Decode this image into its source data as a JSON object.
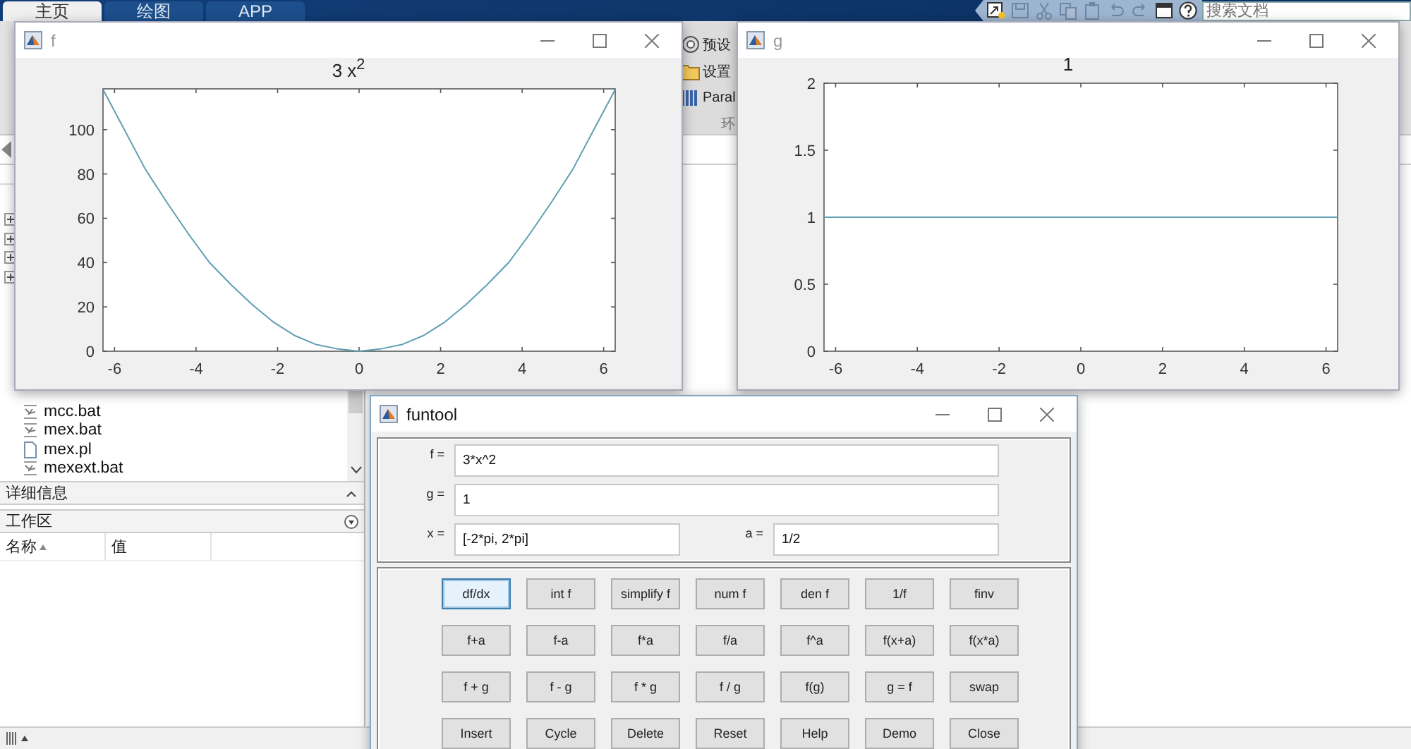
{
  "main_tabs": [
    {
      "label": "主页",
      "selected": true
    },
    {
      "label": "绘图",
      "selected": false
    },
    {
      "label": "APP",
      "selected": false
    }
  ],
  "search": {
    "placeholder": "搜索文档"
  },
  "ribbon": {
    "items": [
      {
        "kind": "gear",
        "label": "预设"
      },
      {
        "kind": "folder",
        "label": "设置"
      },
      {
        "kind": "parallel",
        "label": "Paral"
      }
    ],
    "section": "环"
  },
  "tree_nodes": [
    {
      "expanded": false
    },
    {
      "expanded": false
    },
    {
      "expanded": false
    },
    {
      "expanded": false
    }
  ],
  "files": [
    {
      "name": "mcc.bat",
      "kind": "bat"
    },
    {
      "name": "mex.bat",
      "kind": "bat"
    },
    {
      "name": "mex.pl",
      "kind": "file"
    },
    {
      "name": "mexext.bat",
      "kind": "bat"
    }
  ],
  "details_panel": {
    "title": "详细信息"
  },
  "workspace": {
    "title": "工作区",
    "columns": [
      {
        "label": "名称",
        "sorted": true
      },
      {
        "label": "值",
        "sorted": false
      }
    ]
  },
  "figures": [
    {
      "title": "f",
      "chart_data": {
        "type": "line",
        "title": "3 x$^{2}$",
        "x": [
          -6.28,
          -5.76,
          -5.24,
          -4.71,
          -4.19,
          -3.67,
          -3.14,
          -2.62,
          -2.09,
          -1.57,
          -1.05,
          -0.52,
          0,
          0.52,
          1.05,
          1.57,
          2.09,
          2.62,
          3.14,
          3.67,
          4.19,
          4.71,
          5.24,
          5.76,
          6.28
        ],
        "series": [
          {
            "color": "#5f9fb2",
            "values": [
              118,
              100,
              82,
              67,
              53,
              40,
              30,
              21,
              13,
              7,
              3,
              1,
              0,
              1,
              3,
              7,
              13,
              21,
              30,
              40,
              53,
              67,
              82,
              100,
              118
            ]
          }
        ],
        "xlim": [
          -6.2832,
          6.2832
        ],
        "ylim": [
          0,
          118.4
        ],
        "xticks": [
          -6,
          -4,
          -2,
          0,
          2,
          4,
          6
        ],
        "yticks": [
          0,
          20,
          40,
          60,
          80,
          100
        ]
      }
    },
    {
      "title": "g",
      "chart_data": {
        "type": "line",
        "title": "1",
        "x": [
          -6.2832,
          6.2832
        ],
        "series": [
          {
            "color": "#5f9fb2",
            "values": [
              1,
              1
            ]
          }
        ],
        "xlim": [
          -6.2832,
          6.2832
        ],
        "ylim": [
          0,
          2
        ],
        "xticks": [
          -6,
          -4,
          -2,
          0,
          2,
          4,
          6
        ],
        "yticks": [
          0,
          0.5,
          1,
          1.5,
          2
        ]
      }
    }
  ],
  "funtool": {
    "title": "funtool",
    "fields": [
      {
        "label": "f =",
        "value": "3*x^2"
      },
      {
        "label": "g =",
        "value": "1"
      },
      {
        "label": "x =",
        "value": "[-2*pi, 2*pi]"
      },
      {
        "label": "a =",
        "value": "1/2"
      }
    ],
    "buttons": [
      [
        {
          "label": "df/dx",
          "focused": true
        },
        {
          "label": "int f",
          "focused": false
        },
        {
          "label": "simplify f",
          "focused": false
        },
        {
          "label": "num f",
          "focused": false
        },
        {
          "label": "den f",
          "focused": false
        },
        {
          "label": "1/f",
          "focused": false
        },
        {
          "label": "finv",
          "focused": false
        }
      ],
      [
        {
          "label": "f+a",
          "focused": false
        },
        {
          "label": "f-a",
          "focused": false
        },
        {
          "label": "f*a",
          "focused": false
        },
        {
          "label": "f/a",
          "focused": false
        },
        {
          "label": "f^a",
          "focused": false
        },
        {
          "label": "f(x+a)",
          "focused": false
        },
        {
          "label": "f(x*a)",
          "focused": false
        }
      ],
      [
        {
          "label": "f + g",
          "focused": false
        },
        {
          "label": "f - g",
          "focused": false
        },
        {
          "label": "f * g",
          "focused": false
        },
        {
          "label": "f / g",
          "focused": false
        },
        {
          "label": "f(g)",
          "focused": false
        },
        {
          "label": "g = f",
          "focused": false
        },
        {
          "label": "swap",
          "focused": false
        }
      ],
      [
        {
          "label": "Insert",
          "focused": false
        },
        {
          "label": "Cycle",
          "focused": false
        },
        {
          "label": "Delete",
          "focused": false
        },
        {
          "label": "Reset",
          "focused": false
        },
        {
          "label": "Help",
          "focused": false
        },
        {
          "label": "Demo",
          "focused": false
        },
        {
          "label": "Close",
          "focused": false
        }
      ]
    ]
  }
}
